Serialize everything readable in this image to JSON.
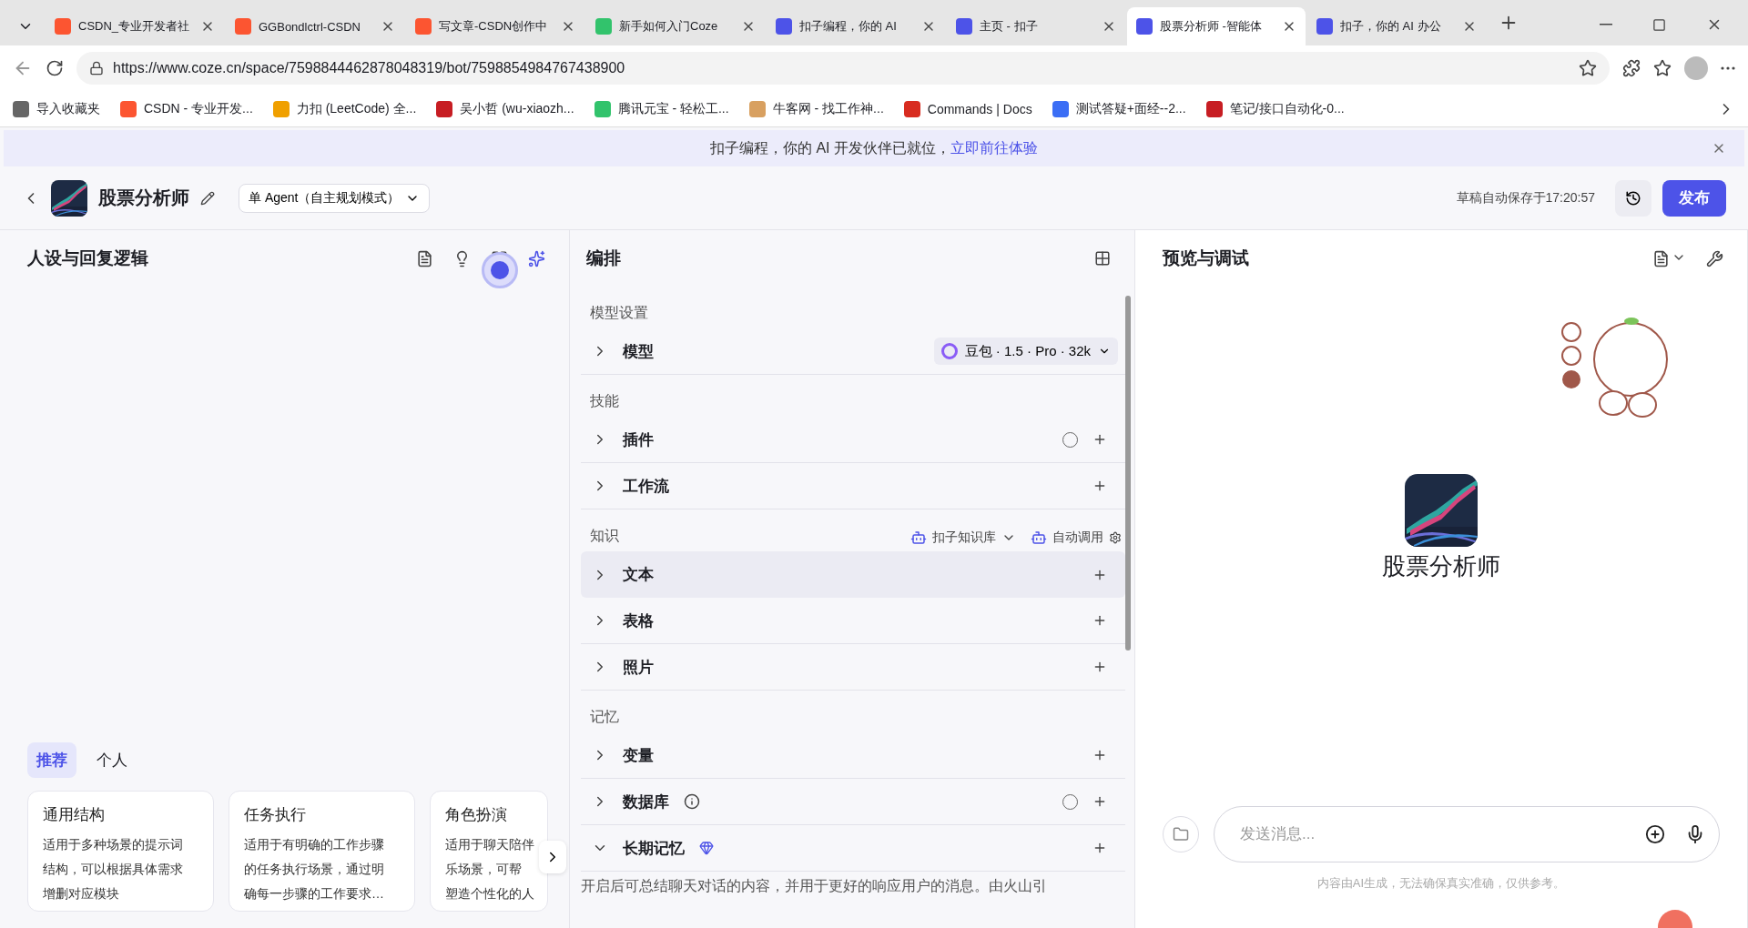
{
  "browser": {
    "tabs": [
      {
        "title": "CSDN_专业开发者社",
        "selected": false,
        "kind": "csdn"
      },
      {
        "title": "GGBondlctrl-CSDN",
        "selected": false,
        "kind": "csdn"
      },
      {
        "title": "写文章-CSDN创作中",
        "selected": false,
        "kind": "csdn"
      },
      {
        "title": "新手如何入门Coze",
        "selected": false,
        "kind": "yuanbao"
      },
      {
        "title": "扣子编程，你的 AI",
        "selected": false,
        "kind": "coze"
      },
      {
        "title": "主页 - 扣子",
        "selected": false,
        "kind": "coze"
      },
      {
        "title": "股票分析师 -智能体",
        "selected": true,
        "kind": "coze"
      },
      {
        "title": "扣子，你的 AI 办公",
        "selected": false,
        "kind": "coze"
      }
    ],
    "url": "https://www.coze.cn/space/7598844462878048319/bot/7598854984767438900",
    "bookmarks": [
      {
        "title": "导入收藏夹",
        "kind": "import"
      },
      {
        "title": "CSDN - 专业开发...",
        "kind": "csdn"
      },
      {
        "title": "力扣 (LeetCode) 全...",
        "kind": "leetcode"
      },
      {
        "title": "吴小哲 (wu-xiaozh...",
        "kind": "gitee"
      },
      {
        "title": "腾讯元宝 - 轻松工...",
        "kind": "yuanbao"
      },
      {
        "title": "牛客网 - 找工作神...",
        "kind": "nowcoder"
      },
      {
        "title": "Commands | Docs",
        "kind": "redis"
      },
      {
        "title": "测试答疑+面经--2...",
        "kind": "doc"
      },
      {
        "title": "笔记/接口自动化-0...",
        "kind": "gitee"
      }
    ]
  },
  "banner": {
    "text": "扣子编程，你的 AI 开发伙伴已就位，",
    "link": "立即前往体验"
  },
  "header": {
    "bot_name": "股票分析师",
    "mode": "单 Agent（自主规划模式）",
    "saved": "草稿自动保存于17:20:57",
    "publish": "发布"
  },
  "persona": {
    "title": "人设与回复逻辑",
    "tabs": [
      {
        "label": "推荐",
        "selected": true
      },
      {
        "label": "个人",
        "selected": false
      }
    ],
    "templates": [
      {
        "title": "通用结构",
        "lines": [
          "适用于多种场景的提示词",
          "结构，可以根据具体需求",
          "增删对应模块"
        ]
      },
      {
        "title": "任务执行",
        "lines": [
          "适用于有明确的工作步骤",
          "的任务执行场景，通过明",
          "确每一步骤的工作要求…"
        ]
      },
      {
        "title": "角色扮演",
        "lines": [
          "适用于聊天陪伴",
          "乐场景，可帮",
          "塑造个性化的人"
        ]
      }
    ]
  },
  "orchestration": {
    "title": "编排",
    "sections": [
      {
        "title": "模型设置",
        "rows": [
          {
            "label": "模型",
            "kind": "model",
            "value": "豆包 · 1.5 · Pro · 32k",
            "expanded": false,
            "highlighted": false
          }
        ]
      },
      {
        "title": "技能",
        "rows": [
          {
            "label": "插件",
            "kind": "auto",
            "expanded": false,
            "highlighted": false
          },
          {
            "label": "工作流",
            "kind": "plain",
            "expanded": false,
            "highlighted": false
          }
        ]
      },
      {
        "title": "知识",
        "source": "扣子知识库",
        "call_mode": "自动调用",
        "rows": [
          {
            "label": "文本",
            "kind": "plain",
            "expanded": false,
            "highlighted": true
          },
          {
            "label": "表格",
            "kind": "plain",
            "expanded": false,
            "highlighted": false
          },
          {
            "label": "照片",
            "kind": "plain",
            "expanded": false,
            "highlighted": false
          }
        ]
      },
      {
        "title": "记忆",
        "rows": [
          {
            "label": "变量",
            "kind": "plain",
            "expanded": false,
            "highlighted": false
          },
          {
            "label": "数据库",
            "kind": "info",
            "expanded": false,
            "highlighted": false
          },
          {
            "label": "长期记忆",
            "kind": "premium",
            "expanded": true,
            "highlighted": false,
            "description": "开启后可总结聊天对话的内容，并用于更好的响应用户的消息。由火山引"
          }
        ]
      }
    ]
  },
  "preview": {
    "title": "预览与调试",
    "bot_name": "股票分析师",
    "placeholder": "发送消息...",
    "disclaimer": "内容由AI生成，无法确保真实准确，仅供参考。"
  }
}
